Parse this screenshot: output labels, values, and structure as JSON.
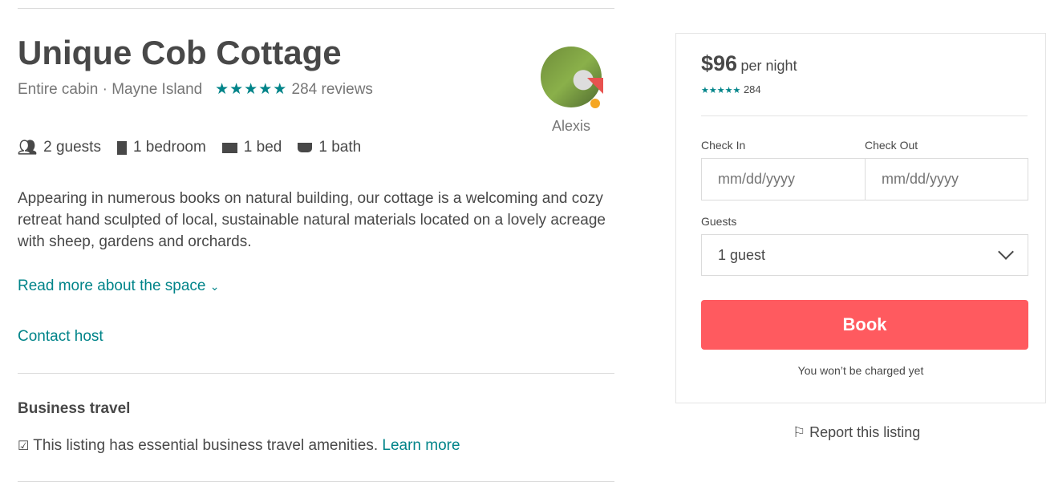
{
  "listing": {
    "title": "Unique Cob Cottage",
    "type": "Entire cabin",
    "location": "Mayne Island",
    "stars": "★★★★★",
    "reviews": "284 reviews",
    "host": "Alexis",
    "amenities": [
      {
        "icon": "guests-icon",
        "label": "2 guests"
      },
      {
        "icon": "door-icon",
        "label": "1 bedroom"
      },
      {
        "icon": "bed-icon",
        "label": "1 bed"
      },
      {
        "icon": "bathtub-icon",
        "label": "1 bath"
      }
    ],
    "description": "Appearing in numerous books on natural building, our cottage is a welcoming and cozy retreat hand sculpted of local, sustainable natural materials located on a lovely acreage with sheep, gardens and orchards.",
    "read_more": "Read more about the space",
    "contact": "Contact host",
    "business_heading": "Business travel",
    "business_text": "This listing has essential business travel amenities.",
    "learn_more": "Learn more"
  },
  "booking": {
    "price": "$96",
    "per": "per night",
    "stars": "★★★★★",
    "review_count": "284",
    "check_in_label": "Check In",
    "check_out_label": "Check Out",
    "date_placeholder": "mm/dd/yyyy",
    "guests_label": "Guests",
    "guests_value": "1 guest",
    "book": "Book",
    "note": "You won’t be charged yet",
    "report": "Report this listing",
    "accent": "#ff5a5f"
  }
}
